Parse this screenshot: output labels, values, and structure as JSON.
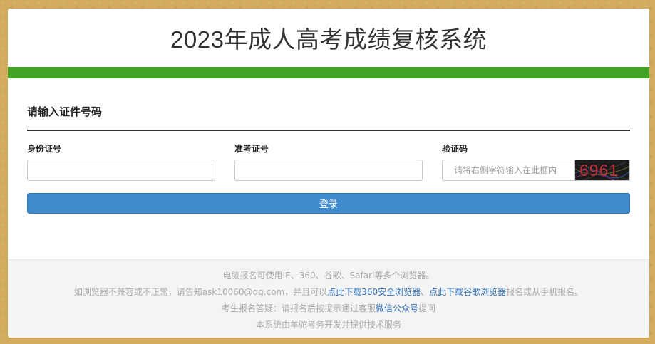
{
  "header": {
    "title": "2023年成人高考成绩复核系统"
  },
  "form": {
    "section_title": "请输入证件号码",
    "id_card_label": "身份证号",
    "id_card_value": "",
    "exam_no_label": "准考证号",
    "exam_no_value": "",
    "captcha_label": "验证码",
    "captcha_placeholder": "请将右侧字符输入在此框内",
    "captcha_text": "6961",
    "login_label": "登录"
  },
  "footer": {
    "line1": "电脑报名可使用IE、360、谷歌、Safari等多个浏览器。",
    "line2_pre": "如浏览器不兼容或不正常，请告知ask10060@qq.com，并且可以",
    "line2_link1": "点此下载360安全浏览器",
    "line2_sep": "、",
    "line2_link2": "点此下载谷歌浏览器",
    "line2_post": "报名或从手机报名。",
    "line3_pre": "考生报名答疑：请报名后按提示通过客服",
    "line3_link": "微信公众号",
    "line3_post": "提问",
    "line4": "本系统由羊驼考务开发并提供技术服务"
  },
  "colors": {
    "page_background": "#d2ab5c",
    "accent_bar": "#43a323",
    "button": "#3f8acb",
    "link": "#2f6fb4"
  }
}
